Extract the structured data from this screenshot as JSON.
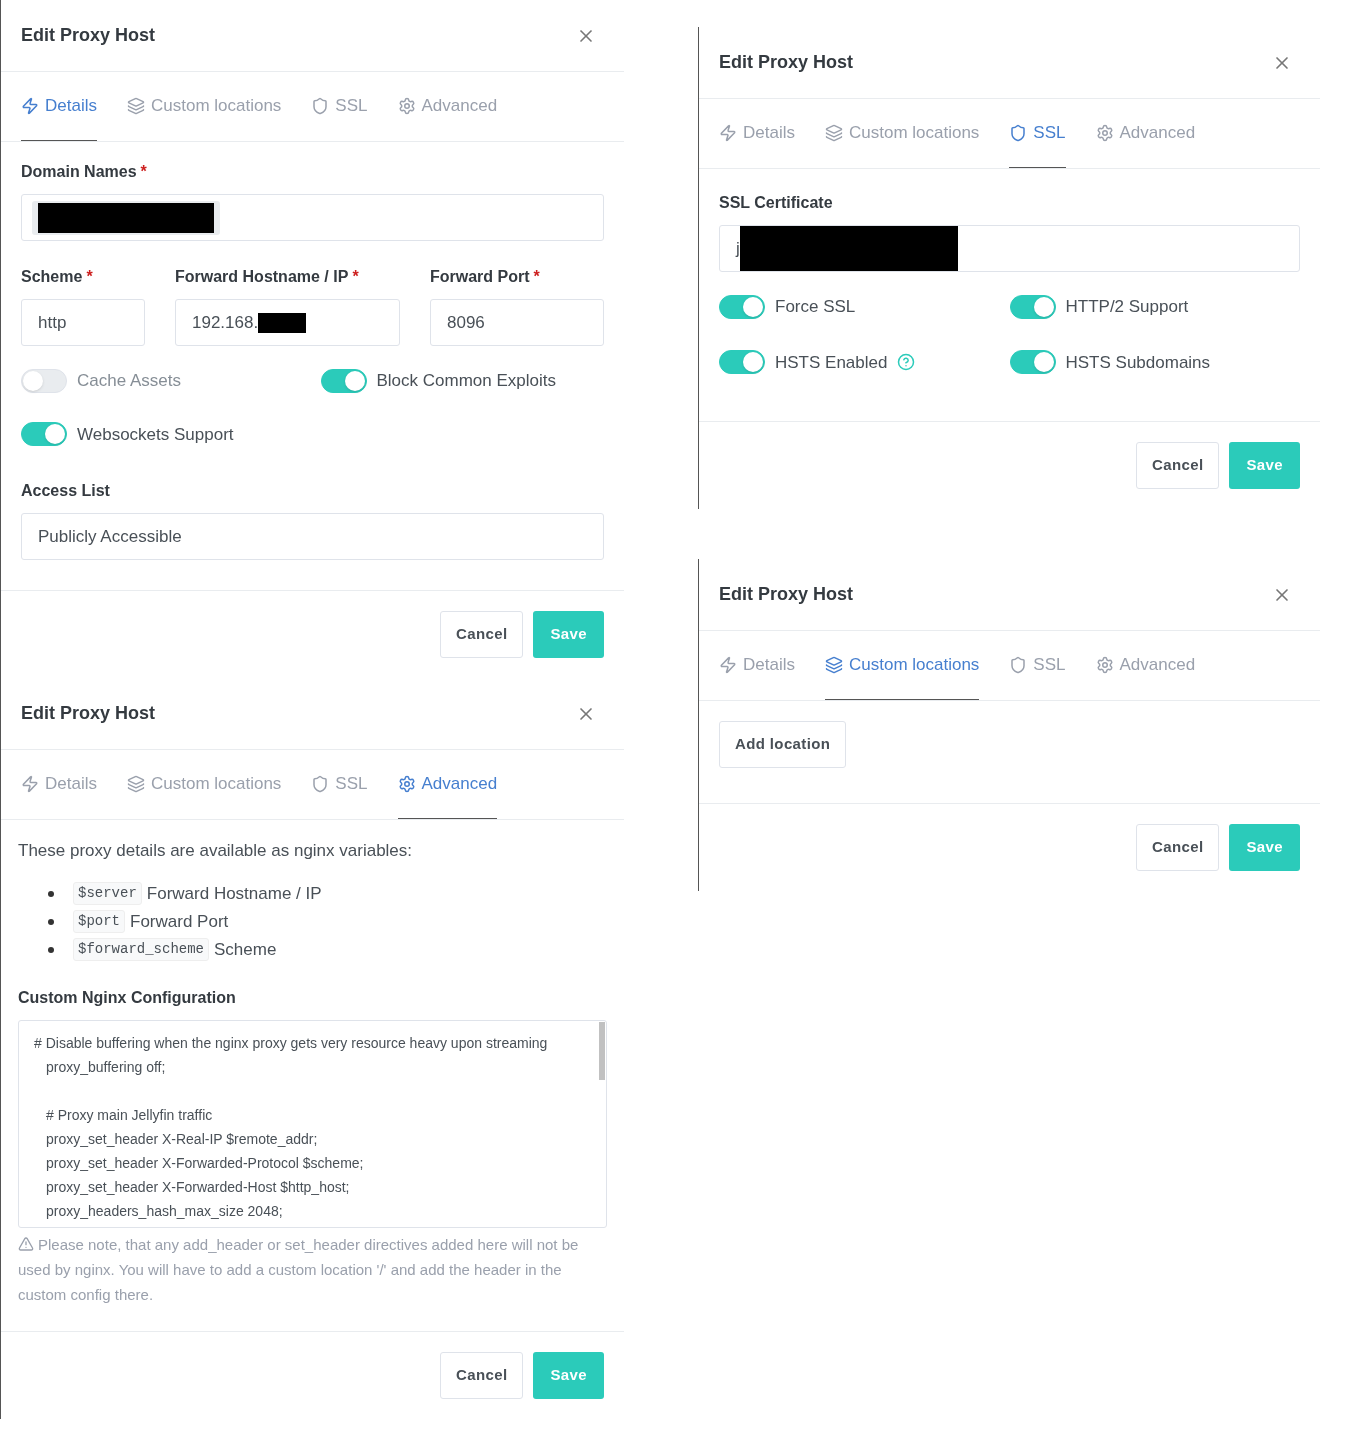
{
  "dialogs": [
    {
      "kind": "details",
      "title": "Edit Proxy Host",
      "tabs": [
        {
          "label": "Details",
          "selected": true
        },
        {
          "label": "Custom locations",
          "selected": false
        },
        {
          "label": "SSL",
          "selected": false
        },
        {
          "label": "Advanced",
          "selected": false
        }
      ],
      "domain_names": {
        "label": "Domain Names",
        "required_mark": "*"
      },
      "fields": [
        {
          "label": "Scheme",
          "required_mark": "*",
          "value": "http",
          "redacted": false
        },
        {
          "label": "Forward Hostname / IP",
          "required_mark": "*",
          "value": "192.168.",
          "redacted": true
        },
        {
          "label": "Forward Port",
          "required_mark": "*",
          "value": "8096",
          "redacted": false
        }
      ],
      "toggles": [
        {
          "label": "Cache Assets",
          "on": false
        },
        {
          "label": "Block Common Exploits",
          "on": true
        },
        {
          "label": "Websockets Support",
          "on": true
        }
      ],
      "access_list": {
        "label": "Access List",
        "value": "Publicly Accessible"
      },
      "buttons": {
        "cancel": "Cancel",
        "save": "Save"
      }
    },
    {
      "kind": "ssl",
      "title": "Edit Proxy Host",
      "tabs": [
        {
          "label": "Details",
          "selected": false
        },
        {
          "label": "Custom locations",
          "selected": false
        },
        {
          "label": "SSL",
          "selected": true
        },
        {
          "label": "Advanced",
          "selected": false
        }
      ],
      "certificate": {
        "label": "SSL Certificate",
        "value": "j"
      },
      "toggles": [
        {
          "label": "Force SSL",
          "on": true,
          "help": false
        },
        {
          "label": "HTTP/2 Support",
          "on": true,
          "help": false
        },
        {
          "label": "HSTS Enabled",
          "on": true,
          "help": true
        },
        {
          "label": "HSTS Subdomains",
          "on": true,
          "help": false
        }
      ],
      "buttons": {
        "cancel": "Cancel",
        "save": "Save"
      }
    },
    {
      "kind": "advanced",
      "title": "Edit Proxy Host",
      "tabs": [
        {
          "label": "Details",
          "selected": false
        },
        {
          "label": "Custom locations",
          "selected": false
        },
        {
          "label": "SSL",
          "selected": false
        },
        {
          "label": "Advanced",
          "selected": true
        }
      ],
      "intro": "These proxy details are available as nginx variables:",
      "variables": [
        {
          "code": "$server",
          "description": "Forward Hostname / IP"
        },
        {
          "code": "$port",
          "description": "Forward Port"
        },
        {
          "code": "$forward_scheme",
          "description": "Scheme"
        }
      ],
      "config_label": "Custom Nginx Configuration",
      "config_lines": [
        {
          "text": "# Disable buffering when the nginx proxy gets very resource heavy upon streaming",
          "indented": false,
          "gap_before": false
        },
        {
          "text": "proxy_buffering off;",
          "indented": true,
          "gap_before": false
        },
        {
          "text": "# Proxy main Jellyfin traffic",
          "indented": true,
          "gap_before": true
        },
        {
          "text": "proxy_set_header X-Real-IP $remote_addr;",
          "indented": true,
          "gap_before": false
        },
        {
          "text": "proxy_set_header X-Forwarded-Protocol $scheme;",
          "indented": true,
          "gap_before": false
        },
        {
          "text": "proxy_set_header X-Forwarded-Host $http_host;",
          "indented": true,
          "gap_before": false
        },
        {
          "text": "proxy_headers_hash_max_size 2048;",
          "indented": true,
          "gap_before": false
        }
      ],
      "note": "Please note, that any add_header or set_header directives added here will not be used by nginx. You will have to add a custom location '/' and add the header in the custom config there.",
      "buttons": {
        "cancel": "Cancel",
        "save": "Save"
      }
    },
    {
      "kind": "locations",
      "title": "Edit Proxy Host",
      "tabs": [
        {
          "label": "Details",
          "selected": false
        },
        {
          "label": "Custom locations",
          "selected": true
        },
        {
          "label": "SSL",
          "selected": false
        },
        {
          "label": "Advanced",
          "selected": false
        }
      ],
      "add_button": "Add location",
      "buttons": {
        "cancel": "Cancel",
        "save": "Save"
      }
    }
  ]
}
